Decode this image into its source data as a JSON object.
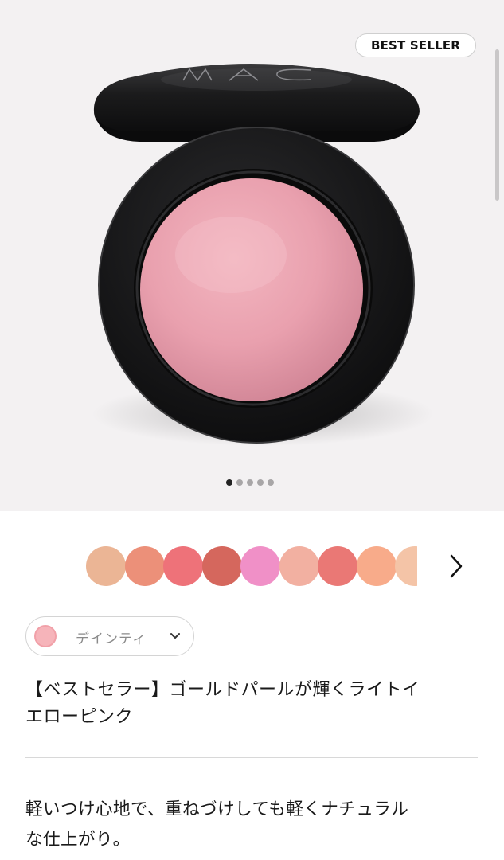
{
  "product_image": {
    "badge": "BEST SELLER",
    "brand_mark": "MAC",
    "pagination": {
      "total": 5,
      "active_index": 0
    }
  },
  "swatches": {
    "colors": [
      "#ebb595",
      "#ec9079",
      "#ee7279",
      "#d5675d",
      "#f090c7",
      "#f2b0a1",
      "#ea7875",
      "#f8ab8a",
      "#f4c4a7"
    ],
    "next_icon": "chevron-right-icon"
  },
  "shade_selector": {
    "swatch_color": "#f6b4ba",
    "selected_label": "デインティ",
    "chevron_icon": "chevron-down-icon"
  },
  "product": {
    "title_line_1": "【ベストセラー】ゴールドパールが輝くライトイ",
    "title_line_2": "エローピンク",
    "description_line_1": "軽いつけ心地で、重ねづけしても軽くナチュラル",
    "description_line_2": "な仕上がり。"
  }
}
